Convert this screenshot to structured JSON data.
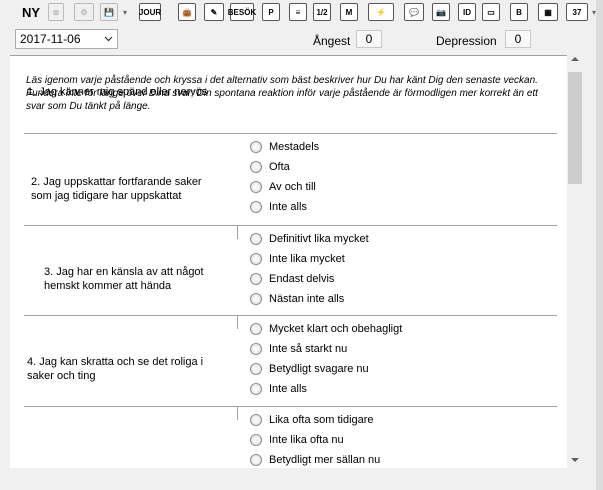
{
  "toolbar": {
    "new_label": "NY",
    "icons": [
      {
        "name": "delete-icon",
        "glyph": "⊗",
        "enabled": false
      },
      {
        "name": "tools-icon",
        "glyph": "⚙",
        "enabled": false
      },
      {
        "name": "save-icon",
        "glyph": "💾",
        "enabled": false
      },
      {
        "name": "journal-icon",
        "glyph": "JOUR",
        "enabled": true
      },
      {
        "name": "briefcase-icon",
        "glyph": "👜",
        "enabled": true
      },
      {
        "name": "edit-icon",
        "glyph": "✎",
        "enabled": true
      },
      {
        "name": "besok-icon",
        "glyph": "BESÖK",
        "enabled": true
      },
      {
        "name": "p-icon",
        "glyph": "P",
        "enabled": true
      },
      {
        "name": "document-icon",
        "glyph": "≡",
        "enabled": true
      },
      {
        "name": "fraction-icon",
        "glyph": "1/2",
        "enabled": true
      },
      {
        "name": "m-icon",
        "glyph": "M",
        "enabled": true
      },
      {
        "name": "lightning-icon",
        "glyph": "⚡",
        "enabled": true
      },
      {
        "name": "chat-icon",
        "glyph": "💬",
        "enabled": true
      },
      {
        "name": "camera-icon",
        "glyph": "📷",
        "enabled": true
      },
      {
        "name": "id-icon",
        "glyph": "ID",
        "enabled": true
      },
      {
        "name": "card-icon",
        "glyph": "▭",
        "enabled": true
      },
      {
        "name": "b-icon",
        "glyph": "B",
        "enabled": true
      },
      {
        "name": "map-icon",
        "glyph": "▦",
        "enabled": true
      },
      {
        "name": "thermometer-icon",
        "glyph": "37",
        "enabled": true
      }
    ]
  },
  "form": {
    "date": "2017-11-06",
    "angest_label": "Ångest",
    "angest_value": "0",
    "depression_label": "Depression",
    "depression_value": "0",
    "intro": "Läs igenom varje påstående och kryssa i det alternativ som bäst beskriver hur Du har känt Dig den senaste veckan. Fundera inte för länge över Dina svar; Din spontana reaktion inför varje påstående är förmodligen mer korrekt än ett svar som Du tänkt på länge.",
    "questions": [
      {
        "text": "1. Jag känner mig spänd eller nervös",
        "options": [
          "Mestadels",
          "Ofta",
          "Av och till",
          "Inte alls"
        ]
      },
      {
        "text": "2. Jag uppskattar fortfarande saker som jag tidigare har uppskattat",
        "options": [
          "Definitivt lika mycket",
          "Inte lika mycket",
          "Endast delvis",
          "Nästan inte alls"
        ]
      },
      {
        "text": "3. Jag har en känsla av att något hemskt kommer att hända",
        "options": [
          "Mycket klart och obehagligt",
          "Inte så starkt nu",
          "Betydligt svagare nu",
          "Inte alls"
        ]
      },
      {
        "text": "4. Jag kan skratta och se det roliga i saker och ting",
        "options": [
          "Lika ofta som tidigare",
          "Inte lika ofta nu",
          "Betydligt mer sällan nu"
        ]
      }
    ]
  }
}
